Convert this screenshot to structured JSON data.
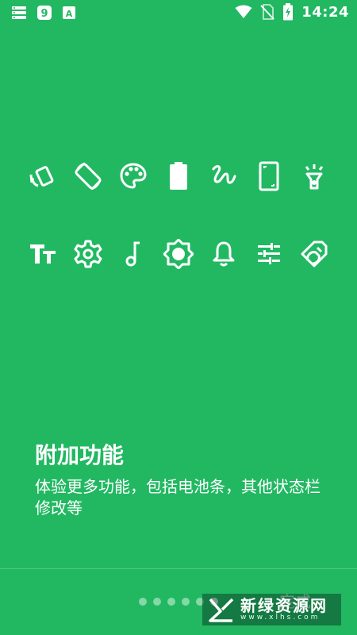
{
  "status_bar": {
    "time": "14:24",
    "left_icons": [
      "storage-icon",
      "app-9-icon",
      "app-a-icon"
    ],
    "right_icons": [
      "wifi-icon",
      "no-sim-icon",
      "battery-charging-icon"
    ]
  },
  "feature_icons": {
    "row1": [
      "auto-rotate-icon",
      "screen-rotation-icon",
      "palette-icon",
      "battery-icon",
      "gesture-icon",
      "screen-frame-icon",
      "flashlight-icon"
    ],
    "row2": [
      "text-size-icon",
      "settings-icon",
      "music-note-icon",
      "brightness-icon",
      "bell-icon",
      "sliders-icon",
      "brush-icon"
    ]
  },
  "content": {
    "title": "附加功能",
    "description": "体验更多功能，包括电池条，其他状态栏修改等"
  },
  "pager": {
    "total": 6,
    "active_index": 5
  },
  "done_button": {
    "label": "完成"
  },
  "watermark": {
    "main": "新绿资源网",
    "sub": "www.xlhs.com"
  },
  "colors": {
    "background": "#22b862",
    "foreground": "#ffffff"
  }
}
